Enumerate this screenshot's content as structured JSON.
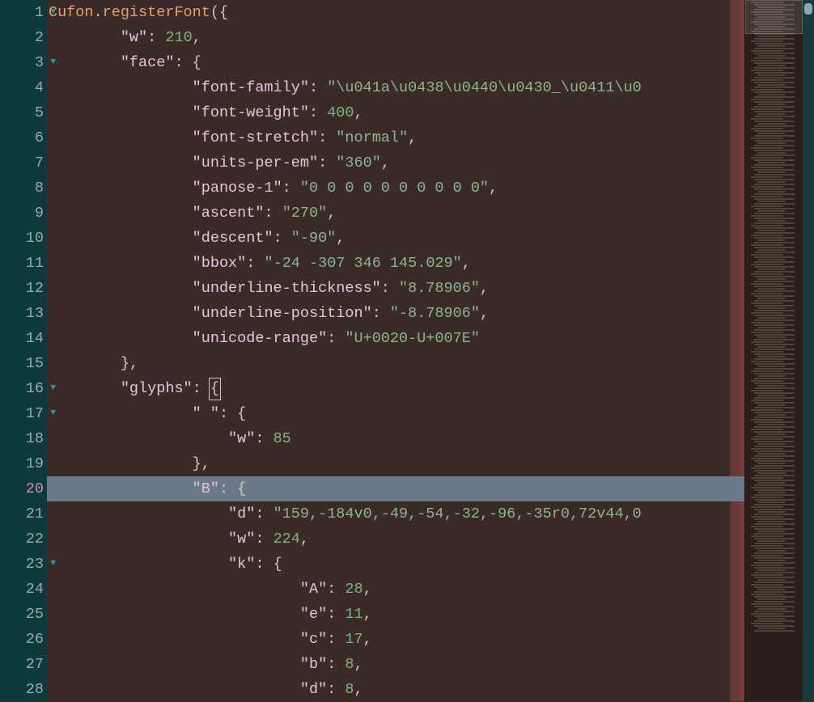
{
  "editor": {
    "highlighted_line_index": 19,
    "lines": [
      {
        "num": 1,
        "fold": true,
        "indent": 0,
        "tokens": [
          {
            "c": "t-ident",
            "t": "Cufon"
          },
          {
            "c": "t-punct",
            "t": "."
          },
          {
            "c": "t-ident",
            "t": "registerFont"
          },
          {
            "c": "t-punct",
            "t": "("
          },
          {
            "c": "t-brace",
            "t": "{"
          }
        ]
      },
      {
        "num": 2,
        "fold": false,
        "indent": 8,
        "tokens": [
          {
            "c": "t-key",
            "t": "\"w\""
          },
          {
            "c": "t-punct",
            "t": ": "
          },
          {
            "c": "t-number",
            "t": "210"
          },
          {
            "c": "t-punct",
            "t": ","
          }
        ]
      },
      {
        "num": 3,
        "fold": true,
        "indent": 8,
        "tokens": [
          {
            "c": "t-key",
            "t": "\"face\""
          },
          {
            "c": "t-punct",
            "t": ": "
          },
          {
            "c": "t-brace",
            "t": "{"
          }
        ]
      },
      {
        "num": 4,
        "fold": false,
        "indent": 16,
        "tokens": [
          {
            "c": "t-key",
            "t": "\"font-family\""
          },
          {
            "c": "t-punct",
            "t": ": "
          },
          {
            "c": "t-string",
            "t": "\""
          },
          {
            "c": "t-escape",
            "t": "\\u041a\\u0438\\u0440\\u0430"
          },
          {
            "c": "t-string",
            "t": "_"
          },
          {
            "c": "t-escape",
            "t": "\\u0411\\u0"
          }
        ]
      },
      {
        "num": 5,
        "fold": false,
        "indent": 16,
        "tokens": [
          {
            "c": "t-key",
            "t": "\"font-weight\""
          },
          {
            "c": "t-punct",
            "t": ": "
          },
          {
            "c": "t-number",
            "t": "400"
          },
          {
            "c": "t-punct",
            "t": ","
          }
        ]
      },
      {
        "num": 6,
        "fold": false,
        "indent": 16,
        "tokens": [
          {
            "c": "t-key",
            "t": "\"font-stretch\""
          },
          {
            "c": "t-punct",
            "t": ": "
          },
          {
            "c": "t-string",
            "t": "\"normal\""
          },
          {
            "c": "t-punct",
            "t": ","
          }
        ]
      },
      {
        "num": 7,
        "fold": false,
        "indent": 16,
        "tokens": [
          {
            "c": "t-key",
            "t": "\"units-per-em\""
          },
          {
            "c": "t-punct",
            "t": ": "
          },
          {
            "c": "t-string",
            "t": "\"360\""
          },
          {
            "c": "t-punct",
            "t": ","
          }
        ]
      },
      {
        "num": 8,
        "fold": false,
        "indent": 16,
        "tokens": [
          {
            "c": "t-key",
            "t": "\"panose-1\""
          },
          {
            "c": "t-punct",
            "t": ": "
          },
          {
            "c": "t-string",
            "t": "\"0 0 0 0 0 0 0 0 0 0\""
          },
          {
            "c": "t-punct",
            "t": ","
          }
        ]
      },
      {
        "num": 9,
        "fold": false,
        "indent": 16,
        "tokens": [
          {
            "c": "t-key",
            "t": "\"ascent\""
          },
          {
            "c": "t-punct",
            "t": ": "
          },
          {
            "c": "t-string",
            "t": "\"270\""
          },
          {
            "c": "t-punct",
            "t": ","
          }
        ]
      },
      {
        "num": 10,
        "fold": false,
        "indent": 16,
        "tokens": [
          {
            "c": "t-key",
            "t": "\"descent\""
          },
          {
            "c": "t-punct",
            "t": ": "
          },
          {
            "c": "t-string",
            "t": "\"-90\""
          },
          {
            "c": "t-punct",
            "t": ","
          }
        ]
      },
      {
        "num": 11,
        "fold": false,
        "indent": 16,
        "tokens": [
          {
            "c": "t-key",
            "t": "\"bbox\""
          },
          {
            "c": "t-punct",
            "t": ": "
          },
          {
            "c": "t-string",
            "t": "\"-24 -307 346 145.029\""
          },
          {
            "c": "t-punct",
            "t": ","
          }
        ]
      },
      {
        "num": 12,
        "fold": false,
        "indent": 16,
        "tokens": [
          {
            "c": "t-key",
            "t": "\"underline-thickness\""
          },
          {
            "c": "t-punct",
            "t": ": "
          },
          {
            "c": "t-string",
            "t": "\"8.78906\""
          },
          {
            "c": "t-punct",
            "t": ","
          }
        ]
      },
      {
        "num": 13,
        "fold": false,
        "indent": 16,
        "tokens": [
          {
            "c": "t-key",
            "t": "\"underline-position\""
          },
          {
            "c": "t-punct",
            "t": ": "
          },
          {
            "c": "t-string",
            "t": "\"-8.78906\""
          },
          {
            "c": "t-punct",
            "t": ","
          }
        ]
      },
      {
        "num": 14,
        "fold": false,
        "indent": 16,
        "tokens": [
          {
            "c": "t-key",
            "t": "\"unicode-range\""
          },
          {
            "c": "t-punct",
            "t": ": "
          },
          {
            "c": "t-string",
            "t": "\"U+0020-U+007E\""
          }
        ]
      },
      {
        "num": 15,
        "fold": false,
        "indent": 8,
        "tokens": [
          {
            "c": "t-brace",
            "t": "}"
          },
          {
            "c": "t-punct",
            "t": ","
          }
        ]
      },
      {
        "num": 16,
        "fold": true,
        "indent": 8,
        "tokens": [
          {
            "c": "t-key",
            "t": "\"glyphs\""
          },
          {
            "c": "t-punct",
            "t": ": "
          },
          {
            "c": "t-brace cursor",
            "t": "{"
          }
        ]
      },
      {
        "num": 17,
        "fold": true,
        "indent": 16,
        "tokens": [
          {
            "c": "t-key",
            "t": "\" \""
          },
          {
            "c": "t-punct",
            "t": ": "
          },
          {
            "c": "t-brace",
            "t": "{"
          }
        ]
      },
      {
        "num": 18,
        "fold": false,
        "indent": 20,
        "tokens": [
          {
            "c": "t-key",
            "t": "\"w\""
          },
          {
            "c": "t-punct",
            "t": ": "
          },
          {
            "c": "t-number",
            "t": "85"
          }
        ]
      },
      {
        "num": 19,
        "fold": false,
        "indent": 16,
        "tokens": [
          {
            "c": "t-brace",
            "t": "}"
          },
          {
            "c": "t-punct",
            "t": ","
          }
        ]
      },
      {
        "num": 20,
        "fold": true,
        "indent": 16,
        "tokens": [
          {
            "c": "t-key",
            "t": "\"B\""
          },
          {
            "c": "t-punct",
            "t": ": "
          },
          {
            "c": "t-brace",
            "t": "{"
          }
        ]
      },
      {
        "num": 21,
        "fold": false,
        "indent": 20,
        "tokens": [
          {
            "c": "t-key",
            "t": "\"d\""
          },
          {
            "c": "t-punct",
            "t": ": "
          },
          {
            "c": "t-string",
            "t": "\"159,-184v0,-49,-54,-32,-96,-35r0,72v44,0"
          }
        ]
      },
      {
        "num": 22,
        "fold": false,
        "indent": 20,
        "tokens": [
          {
            "c": "t-key",
            "t": "\"w\""
          },
          {
            "c": "t-punct",
            "t": ": "
          },
          {
            "c": "t-number",
            "t": "224"
          },
          {
            "c": "t-punct",
            "t": ","
          }
        ]
      },
      {
        "num": 23,
        "fold": true,
        "indent": 20,
        "tokens": [
          {
            "c": "t-key",
            "t": "\"k\""
          },
          {
            "c": "t-punct",
            "t": ": "
          },
          {
            "c": "t-brace",
            "t": "{"
          }
        ]
      },
      {
        "num": 24,
        "fold": false,
        "indent": 28,
        "tokens": [
          {
            "c": "t-key",
            "t": "\"A\""
          },
          {
            "c": "t-punct",
            "t": ": "
          },
          {
            "c": "t-number",
            "t": "28"
          },
          {
            "c": "t-punct",
            "t": ","
          }
        ]
      },
      {
        "num": 25,
        "fold": false,
        "indent": 28,
        "tokens": [
          {
            "c": "t-key",
            "t": "\"e\""
          },
          {
            "c": "t-punct",
            "t": ": "
          },
          {
            "c": "t-number",
            "t": "11"
          },
          {
            "c": "t-punct",
            "t": ","
          }
        ]
      },
      {
        "num": 26,
        "fold": false,
        "indent": 28,
        "tokens": [
          {
            "c": "t-key",
            "t": "\"c\""
          },
          {
            "c": "t-punct",
            "t": ": "
          },
          {
            "c": "t-number",
            "t": "17"
          },
          {
            "c": "t-punct",
            "t": ","
          }
        ]
      },
      {
        "num": 27,
        "fold": false,
        "indent": 28,
        "tokens": [
          {
            "c": "t-key",
            "t": "\"b\""
          },
          {
            "c": "t-punct",
            "t": ": "
          },
          {
            "c": "t-number",
            "t": "8"
          },
          {
            "c": "t-punct",
            "t": ","
          }
        ]
      },
      {
        "num": 28,
        "fold": false,
        "indent": 28,
        "tokens": [
          {
            "c": "t-key",
            "t": "\"d\""
          },
          {
            "c": "t-punct",
            "t": ": "
          },
          {
            "c": "t-number",
            "t": "8"
          },
          {
            "c": "t-punct",
            "t": ","
          }
        ]
      }
    ]
  },
  "fold_glyph": "▼"
}
